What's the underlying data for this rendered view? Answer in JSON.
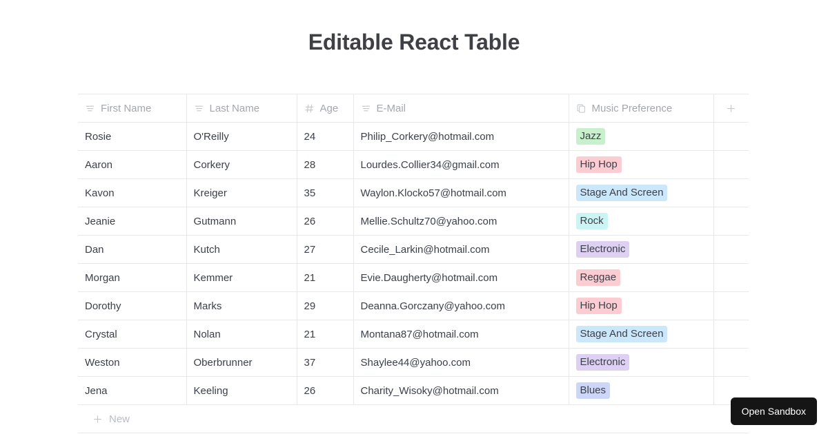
{
  "page": {
    "title": "Editable React Table"
  },
  "table": {
    "columns": [
      {
        "label": "First Name",
        "icon": "text-lines-icon",
        "type": "text"
      },
      {
        "label": "Last Name",
        "icon": "text-lines-icon",
        "type": "text"
      },
      {
        "label": "Age",
        "icon": "hash-icon",
        "type": "number"
      },
      {
        "label": "E-Mail",
        "icon": "text-lines-icon",
        "type": "text"
      },
      {
        "label": "Music Preference",
        "icon": "copy-icon",
        "type": "select"
      }
    ],
    "add_column_icon": "plus-icon",
    "add_column_label": "+",
    "rows": [
      {
        "first_name": "Rosie",
        "last_name": "O'Reilly",
        "age": "24",
        "email": "Philip_Corkery@hotmail.com",
        "music": "Jazz",
        "music_color": "#c8f0cd"
      },
      {
        "first_name": "Aaron",
        "last_name": "Corkery",
        "age": "28",
        "email": "Lourdes.Collier34@gmail.com",
        "music": "Hip Hop",
        "music_color": "#fbcdd2"
      },
      {
        "first_name": "Kavon",
        "last_name": "Kreiger",
        "age": "35",
        "email": "Waylon.Klocko57@hotmail.com",
        "music": "Stage And Screen",
        "music_color": "#cbe7fb"
      },
      {
        "first_name": "Jeanie",
        "last_name": "Gutmann",
        "age": "26",
        "email": "Mellie.Schultz70@yahoo.com",
        "music": "Rock",
        "music_color": "#cbf5f5"
      },
      {
        "first_name": "Dan",
        "last_name": "Kutch",
        "age": "27",
        "email": "Cecile_Larkin@hotmail.com",
        "music": "Electronic",
        "music_color": "#ddd0f2"
      },
      {
        "first_name": "Morgan",
        "last_name": "Kemmer",
        "age": "21",
        "email": "Evie.Daugherty@hotmail.com",
        "music": "Reggae",
        "music_color": "#fbcdd2"
      },
      {
        "first_name": "Dorothy",
        "last_name": "Marks",
        "age": "29",
        "email": "Deanna.Gorczany@yahoo.com",
        "music": "Hip Hop",
        "music_color": "#fbcdd2"
      },
      {
        "first_name": "Crystal",
        "last_name": "Nolan",
        "age": "21",
        "email": "Montana87@hotmail.com",
        "music": "Stage And Screen",
        "music_color": "#cbe7fb"
      },
      {
        "first_name": "Weston",
        "last_name": "Oberbrunner",
        "age": "37",
        "email": "Shaylee44@yahoo.com",
        "music": "Electronic",
        "music_color": "#ddd0f2"
      },
      {
        "first_name": "Jena",
        "last_name": "Keeling",
        "age": "26",
        "email": "Charity_Wisoky@hotmail.com",
        "music": "Blues",
        "music_color": "#ccd6f8"
      }
    ],
    "new_row": {
      "label": "New",
      "icon": "plus-icon"
    }
  },
  "sandbox": {
    "label": "Open Sandbox"
  },
  "colors": {
    "title": "#3f3f46",
    "text": "#3b4049",
    "muted": "#a3a7ae",
    "border": "#e8e8e8",
    "sandbox_bg": "#151515",
    "sandbox_fg": "#ffffff"
  }
}
